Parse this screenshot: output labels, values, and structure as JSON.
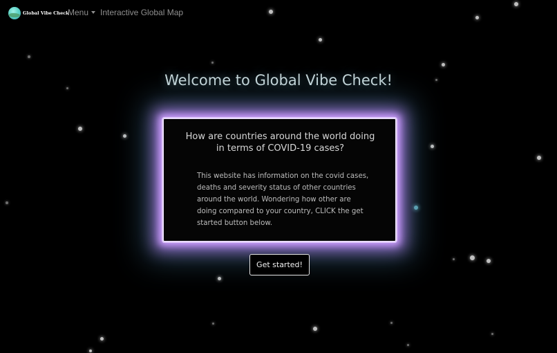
{
  "nav": {
    "brand": "Global Vibe Check",
    "menu_label": "Menu",
    "map_link": "Interactive Global Map"
  },
  "hero": {
    "title": "Welcome to Global Vibe Check!",
    "question": "How are countries around the world doing in terms of COVID-19 cases?",
    "body": "This website has information on the covid cases, deaths and severity status of other countries around the world. Wondering how other are doing compared to your country, CLICK the get started button below.",
    "cta_label": "Get started!"
  },
  "colors": {
    "background": "#000000",
    "nav_text": "#8f8f8f",
    "title_text": "#c6d6d8",
    "glow_primary": "#cda0ff",
    "glow_secondary": "#5096be"
  },
  "icons": {
    "logo": "globe-icon",
    "menu_caret": "caret-down-icon"
  }
}
